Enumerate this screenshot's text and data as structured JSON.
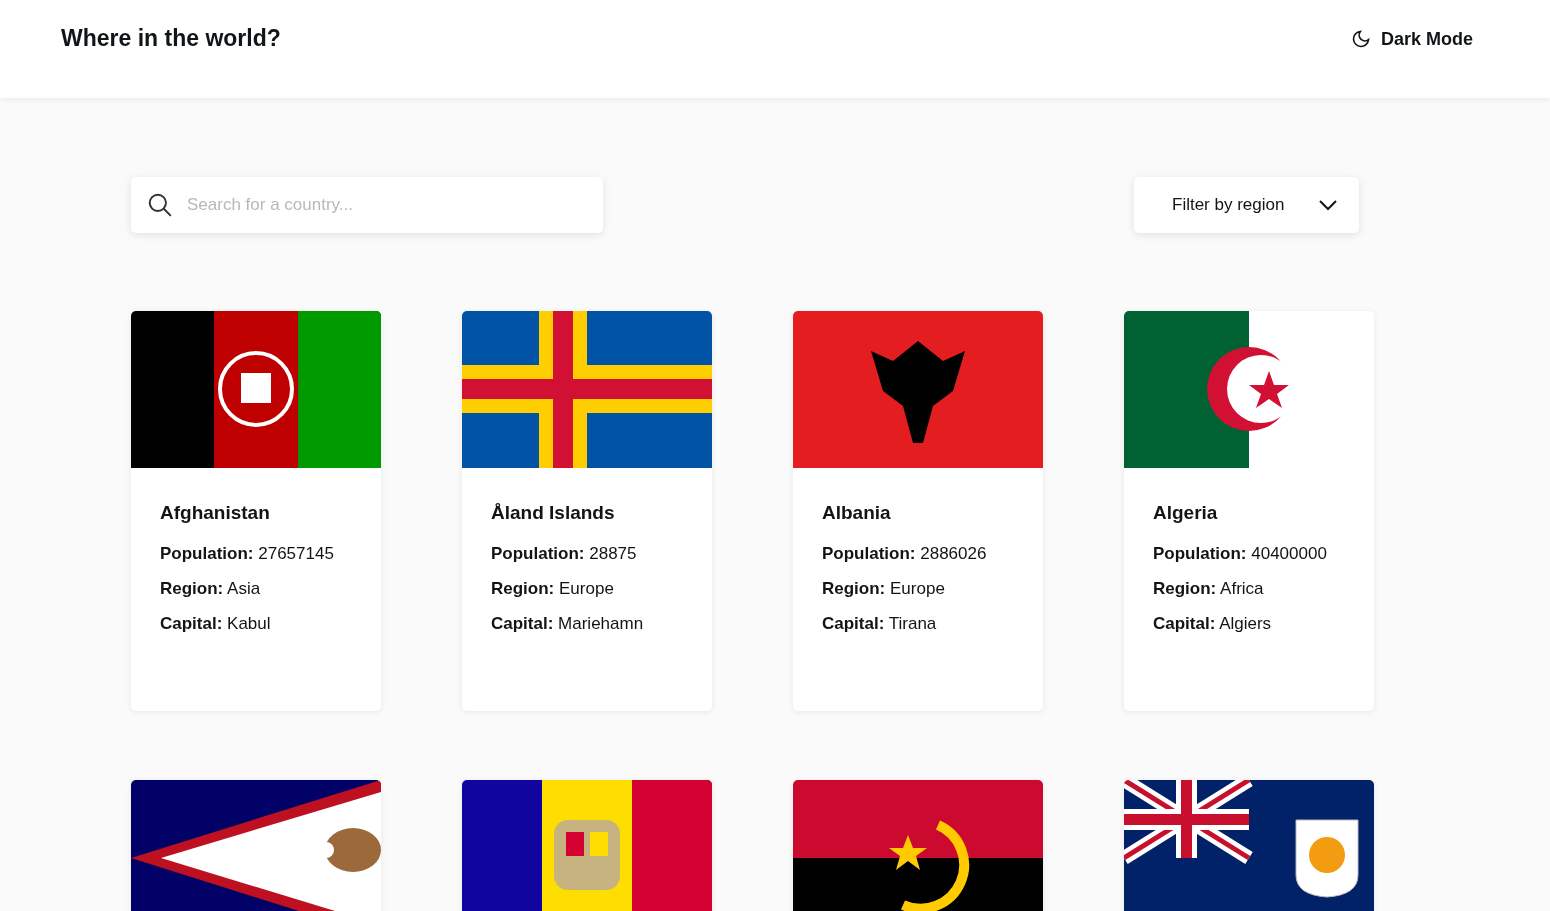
{
  "header": {
    "title": "Where in the world?",
    "theme_toggle": "Dark Mode"
  },
  "search": {
    "placeholder": "Search for a country..."
  },
  "filter": {
    "label": "Filter by region"
  },
  "countries": [
    {
      "flag": {
        "kind": "picture"
      },
      "name": "Afghanistan",
      "fields": [
        {
          "label": "Population:",
          "value": "27657145"
        },
        {
          "label": "Region:",
          "value": "Asia"
        },
        {
          "label": "Capital:",
          "value": "Kabul"
        }
      ]
    },
    {
      "flag": {
        "kind": "picture"
      },
      "name": "Åland Islands",
      "fields": [
        {
          "label": "Population:",
          "value": "28875"
        },
        {
          "label": "Region:",
          "value": "Europe"
        },
        {
          "label": "Capital:",
          "value": "Mariehamn"
        }
      ]
    },
    {
      "flag": {
        "kind": "picture"
      },
      "name": "Albania",
      "fields": [
        {
          "label": "Population:",
          "value": "2886026"
        },
        {
          "label": "Region:",
          "value": "Europe"
        },
        {
          "label": "Capital:",
          "value": "Tirana"
        }
      ]
    },
    {
      "flag": {
        "kind": "picture"
      },
      "name": "Algeria",
      "fields": [
        {
          "label": "Population:",
          "value": "40400000"
        },
        {
          "label": "Region:",
          "value": "Africa"
        },
        {
          "label": "Capital:",
          "value": "Algiers"
        }
      ]
    },
    {
      "flag": {
        "kind": "picture"
      }
    },
    {
      "flag": {
        "kind": "picture"
      }
    },
    {
      "flag": {
        "kind": "picture"
      }
    },
    {
      "flag": {
        "kind": "picture"
      }
    }
  ]
}
